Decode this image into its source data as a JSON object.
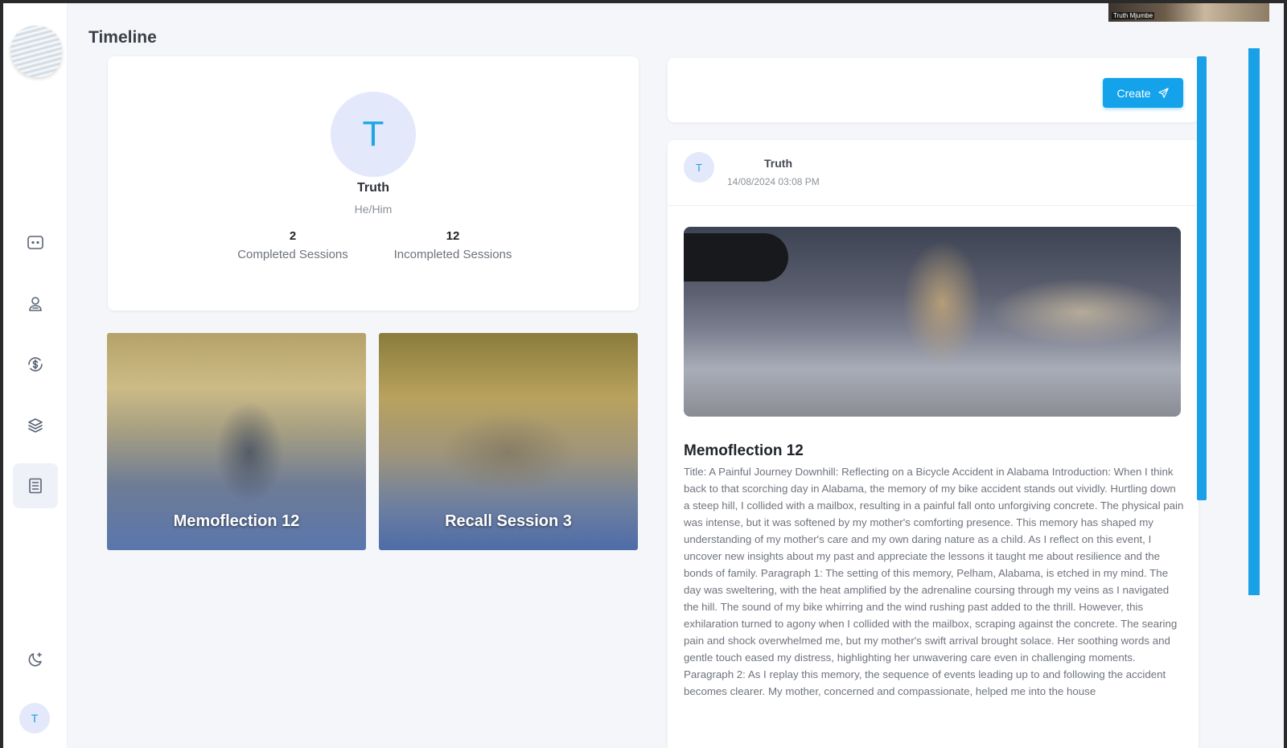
{
  "header": {
    "title": "Timeline"
  },
  "webcam": {
    "label": "Truth Mjumbe"
  },
  "sidebar": {
    "items": [
      {
        "name": "chat",
        "icon": "chat-bubble-icon"
      },
      {
        "name": "profile",
        "icon": "user-icon"
      },
      {
        "name": "billing",
        "icon": "dollar-circle-icon"
      },
      {
        "name": "layers",
        "icon": "layers-icon"
      },
      {
        "name": "timeline",
        "icon": "document-icon",
        "active": true
      }
    ],
    "theme_icon": "moon-stars-icon",
    "user_initial": "T"
  },
  "profile": {
    "initial": "T",
    "name": "Truth",
    "pronouns": "He/Him",
    "completed_count": "2",
    "completed_label": "Completed Sessions",
    "incompleted_count": "12",
    "incompleted_label": "Incompleted Sessions"
  },
  "sessions": [
    {
      "title": "Memoflection 12"
    },
    {
      "title": "Recall Session 3"
    }
  ],
  "create": {
    "label": "Create",
    "icon": "send-icon"
  },
  "post": {
    "author_initial": "T",
    "author": "Truth",
    "date": "14/08/2024 03:08 PM",
    "title": "Memoflection 12",
    "body": "Title: A Painful Journey Downhill: Reflecting on a Bicycle Accident in Alabama Introduction: When I think back to that scorching day in Alabama, the memory of my bike accident stands out vividly. Hurtling down a steep hill, I collided with a mailbox, resulting in a painful fall onto unforgiving concrete. The physical pain was intense, but it was softened by my mother's comforting presence. This memory has shaped my understanding of my mother's care and my own daring nature as a child. As I reflect on this event, I uncover new insights about my past and appreciate the lessons it taught me about resilience and the bonds of family. Paragraph 1: The setting of this memory, Pelham, Alabama, is etched in my mind. The day was sweltering, with the heat amplified by the adrenaline coursing through my veins as I navigated the hill. The sound of my bike whirring and the wind rushing past added to the thrill. However, this exhilaration turned to agony when I collided with the mailbox, scraping against the concrete. The searing pain and shock overwhelmed me, but my mother's swift arrival brought solace. Her soothing words and gentle touch eased my distress, highlighting her unwavering care even in challenging moments. Paragraph 2: As I replay this memory, the sequence of events leading up to and following the accident becomes clearer. My mother, concerned and compassionate, helped me into the house"
  }
}
